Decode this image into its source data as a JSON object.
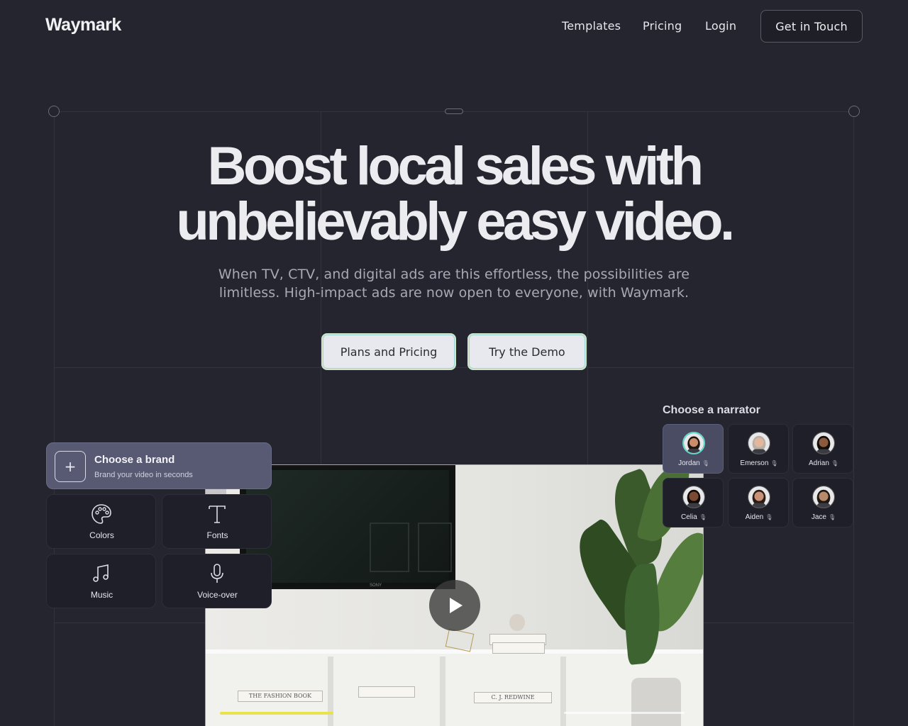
{
  "nav": {
    "logo": "Waymark",
    "links": [
      "Templates",
      "Pricing",
      "Login"
    ],
    "cta": "Get in Touch"
  },
  "hero": {
    "headline_line1": "Boost local sales with",
    "headline_line2": "unbelievably easy video.",
    "subtitle_line1": "When TV, CTV, and digital ads are this effortless, the possibilities are",
    "subtitle_line2": "limitless. High-impact ads are now open to everyone, with Waymark.",
    "primary_button": "Plans and Pricing",
    "secondary_button": "Try the Demo"
  },
  "brand_panel": {
    "title": "Choose a brand",
    "subtitle": "Brand your video in seconds",
    "tools": [
      {
        "label": "Colors",
        "icon": "palette-icon"
      },
      {
        "label": "Fonts",
        "icon": "type-icon"
      },
      {
        "label": "Music",
        "icon": "music-icon"
      },
      {
        "label": "Voice-over",
        "icon": "microphone-icon"
      }
    ]
  },
  "video": {
    "play_icon": "play-icon",
    "tv_brand": "SONY",
    "book_left": "THE FASHION BOOK",
    "book_right": "C. J. REDWINE",
    "progress_color": "#e8e34a"
  },
  "narrator_panel": {
    "title": "Choose a narrator",
    "narrators": [
      {
        "name": "Jordan",
        "selected": true,
        "skin": "#c98d6a",
        "hair": "#1c1410"
      },
      {
        "name": "Emerson",
        "selected": false,
        "skin": "#e2b79e",
        "hair": "#b8b0a6"
      },
      {
        "name": "Adrian",
        "selected": false,
        "skin": "#8a5a3f",
        "hair": "#120c08"
      },
      {
        "name": "Celia",
        "selected": false,
        "skin": "#7a4a32",
        "hair": "#0f0a07"
      },
      {
        "name": "Aiden",
        "selected": false,
        "skin": "#c99276",
        "hair": "#2a1d15"
      },
      {
        "name": "Jace",
        "selected": false,
        "skin": "#b88a6c",
        "hair": "#1f1711"
      }
    ]
  },
  "colors": {
    "background": "#25252f",
    "accent_teal": "#62d8c8",
    "accent_yellow": "#e8e34a"
  }
}
